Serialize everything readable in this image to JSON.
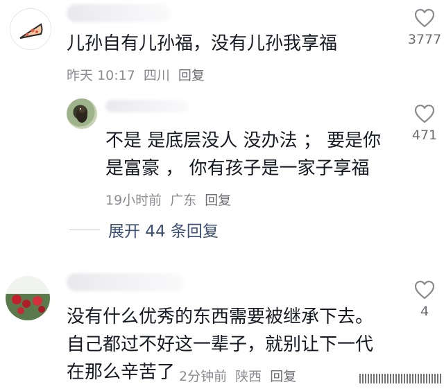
{
  "comments": [
    {
      "text": "儿孙自有儿孙福，没有儿孙我享福",
      "time": "昨天 10:17",
      "location": "四川",
      "reply_label": "回复",
      "likes": "3777"
    },
    {
      "text_line1": "不是  是底层没人 没办法 ； 要是你",
      "text_line2": "是富豪 ， 你有孩子是一家子享福",
      "time": "19小时前",
      "location": "广东",
      "reply_label": "回复",
      "likes": "471"
    },
    {
      "text_line1": "没有什么优秀的东西需要被继承下去。",
      "text_line2": "自己都过不好这一辈子，就别让下一代",
      "text_line3": "在那么辛苦了",
      "time": "2分钟前",
      "location": "陕西",
      "reply_label": "回复",
      "likes": "4"
    }
  ],
  "expand_replies": "展开 44 条回复",
  "icons": {
    "like": "heart-outline-icon"
  },
  "colors": {
    "text": "#161823",
    "meta": "#8a8b91",
    "link": "#3b4f73"
  }
}
